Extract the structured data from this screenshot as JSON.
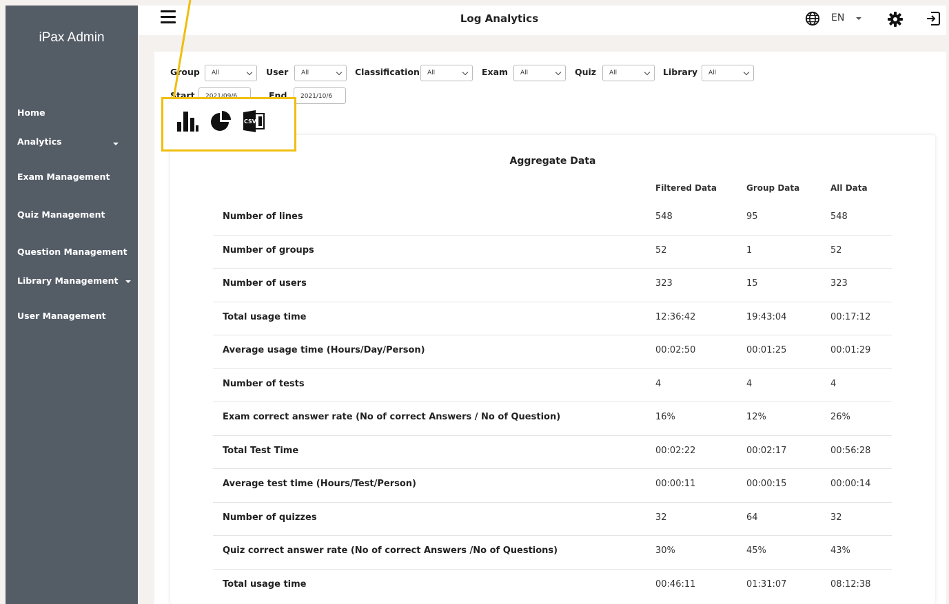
{
  "sidebar": {
    "brand": "iPax Admin",
    "items": [
      {
        "label": "Home",
        "caret": false
      },
      {
        "label": "Analytics",
        "caret": true
      },
      {
        "label": "Exam Management",
        "caret": false
      },
      {
        "label": "Quiz Management",
        "caret": false
      },
      {
        "label": "Question Management",
        "caret": false
      },
      {
        "label": "Library Management",
        "caret": true
      },
      {
        "label": "User Management",
        "caret": false
      }
    ]
  },
  "header": {
    "title": "Log Analytics",
    "language": "EN",
    "icons": [
      "hamburger-menu-icon",
      "globe-icon",
      "gear-icon",
      "logout-icon"
    ]
  },
  "filters": {
    "group_label": "Group",
    "group_value": "All",
    "user_label": "User",
    "user_value": "All",
    "classification_label": "Classification",
    "classification_value": "All",
    "exam_label": "Exam",
    "exam_value": "All",
    "quiz_label": "Quiz",
    "quiz_value": "All",
    "library_label": "Library",
    "library_value": "All",
    "start_label": "Start",
    "start_value": "2021/09/6",
    "end_label": "End",
    "end_value": "2021/10/6"
  },
  "tools": {
    "icons": [
      "bar-chart-icon",
      "pie-chart-icon",
      "csv-export-icon"
    ],
    "csv_text": "CSV",
    "highlight_color": "#f0be0d"
  },
  "aggregate": {
    "title": "Aggregate Data",
    "columns": [
      "Filtered Data",
      "Group Data",
      "All Data"
    ],
    "rows": [
      {
        "label": "Number of lines",
        "filtered": "548",
        "group": "95",
        "all": "548"
      },
      {
        "label": "Number of groups",
        "filtered": "52",
        "group": "1",
        "all": "52"
      },
      {
        "label": "Number of users",
        "filtered": "323",
        "group": "15",
        "all": "323"
      },
      {
        "label": "Total usage time",
        "filtered": "12:36:42",
        "group": "19:43:04",
        "all": "00:17:12"
      },
      {
        "label": "Average usage time (Hours/Day/Person)",
        "filtered": "00:02:50",
        "group": "00:01:25",
        "all": "00:01:29"
      },
      {
        "label": "Number of tests",
        "filtered": "4",
        "group": "4",
        "all": "4"
      },
      {
        "label": "Exam correct answer rate (No of correct Answers / No of Question)",
        "filtered": "16%",
        "group": "12%",
        "all": "26%"
      },
      {
        "label": "Total Test Time",
        "filtered": "00:02:22",
        "group": "00:02:17",
        "all": "00:56:28"
      },
      {
        "label": "Average test time (Hours/Test/Person)",
        "filtered": "00:00:11",
        "group": "00:00:15",
        "all": "00:00:14"
      },
      {
        "label": "Number of quizzes",
        "filtered": "32",
        "group": "64",
        "all": "32"
      },
      {
        "label": "Quiz correct answer rate (No of correct Answers /No of Questions)",
        "filtered": "30%",
        "group": "45%",
        "all": "43%"
      },
      {
        "label": "Total usage time",
        "filtered": "00:46:11",
        "group": "01:31:07",
        "all": "08:12:38"
      }
    ]
  },
  "colors": {
    "sidebar_bg": "#545c66",
    "page_bg": "#f4f1ee",
    "accent_highlight": "#f0be0d"
  }
}
